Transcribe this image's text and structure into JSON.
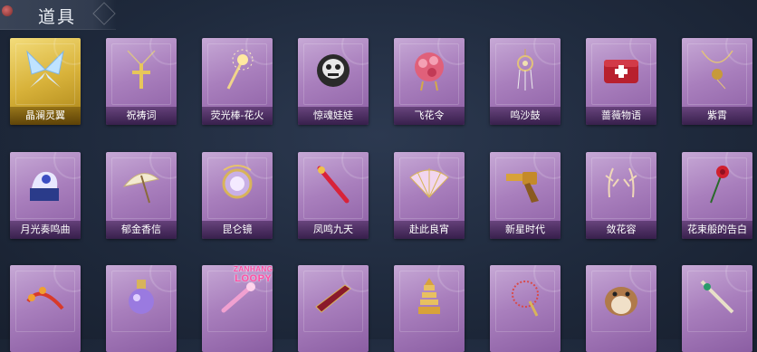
{
  "header": {
    "title": "道具"
  },
  "rows": [
    [
      {
        "label": "晶澜灵翼",
        "icon": "crystal-wings-icon",
        "gold": true
      },
      {
        "label": "祝祷词",
        "icon": "cross-pendant-icon"
      },
      {
        "label": "荧光棒-花火",
        "icon": "firework-wand-icon"
      },
      {
        "label": "惊魂娃娃",
        "icon": "skull-doll-icon"
      },
      {
        "label": "飞花令",
        "icon": "flower-ball-icon"
      },
      {
        "label": "鸣沙鼓",
        "icon": "dreamcatcher-icon"
      },
      {
        "label": "蔷薇物语",
        "icon": "medkit-icon"
      },
      {
        "label": "紫霄",
        "icon": "amulet-icon"
      }
    ],
    [
      {
        "label": "月光奏鸣曲",
        "icon": "music-box-icon"
      },
      {
        "label": "郁金香信",
        "icon": "parasol-icon"
      },
      {
        "label": "昆仑镜",
        "icon": "mirror-icon"
      },
      {
        "label": "凤鸣九天",
        "icon": "phoenix-sword-icon"
      },
      {
        "label": "赴此良宵",
        "icon": "fan-icon"
      },
      {
        "label": "新星时代",
        "icon": "revolver-icon"
      },
      {
        "label": "敛花容",
        "icon": "antler-icon"
      },
      {
        "label": "花束般的告白",
        "icon": "rose-icon"
      }
    ],
    [
      {
        "label": "",
        "icon": "flower-whip-icon"
      },
      {
        "label": "",
        "icon": "potion-bottle-icon"
      },
      {
        "label": "",
        "icon": "pink-wand-icon"
      },
      {
        "label": "",
        "icon": "crimson-blade-icon"
      },
      {
        "label": "",
        "icon": "pagoda-icon"
      },
      {
        "label": "",
        "icon": "chain-staff-icon"
      },
      {
        "label": "",
        "icon": "hamster-icon"
      },
      {
        "label": "",
        "icon": "jade-sword-icon"
      }
    ]
  ],
  "watermark": {
    "line1": "ZANHANG",
    "line2": "LOOPY"
  },
  "colors": {
    "card": "#a97fbd",
    "gold_card": "#d8b23a",
    "background": "#1f2a3d"
  }
}
